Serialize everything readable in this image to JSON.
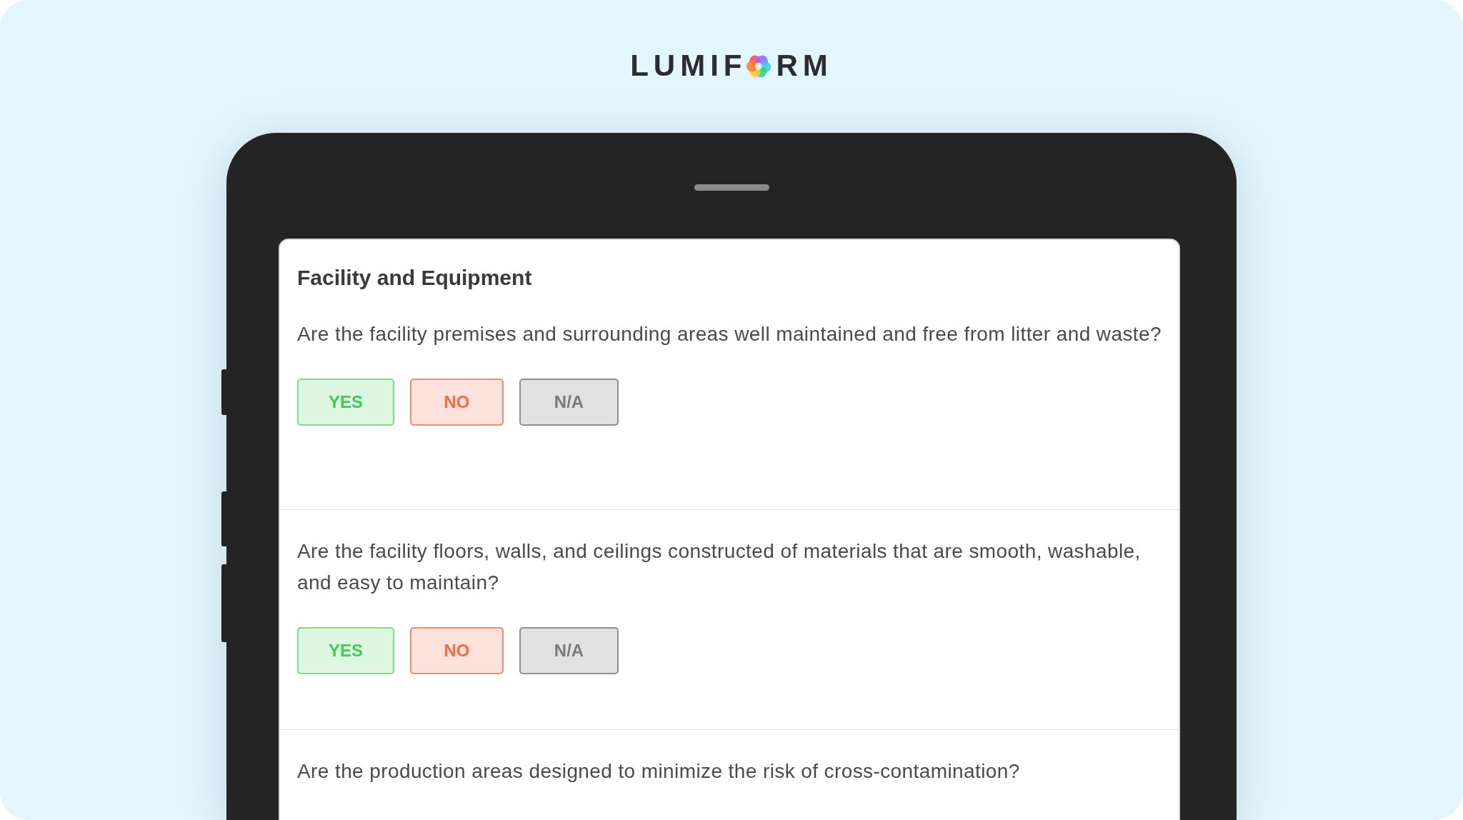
{
  "logo": {
    "before": "LUMIF",
    "after": "RM"
  },
  "form": {
    "title": "Facility and Equipment",
    "questions": [
      {
        "text": "Are the facility premises and surrounding areas well maintained and free from litter and waste?",
        "options": [
          {
            "label": "YES",
            "kind": "yes"
          },
          {
            "label": "NO",
            "kind": "no"
          },
          {
            "label": "N/A",
            "kind": "na"
          }
        ]
      },
      {
        "text": "Are the facility floors, walls, and ceilings constructed of materials that are smooth, washable, and easy to maintain?",
        "options": [
          {
            "label": "YES",
            "kind": "yes"
          },
          {
            "label": "NO",
            "kind": "no"
          },
          {
            "label": "N/A",
            "kind": "na"
          }
        ]
      },
      {
        "text": "Are the production areas designed to minimize the risk of cross-contamination?"
      }
    ]
  }
}
